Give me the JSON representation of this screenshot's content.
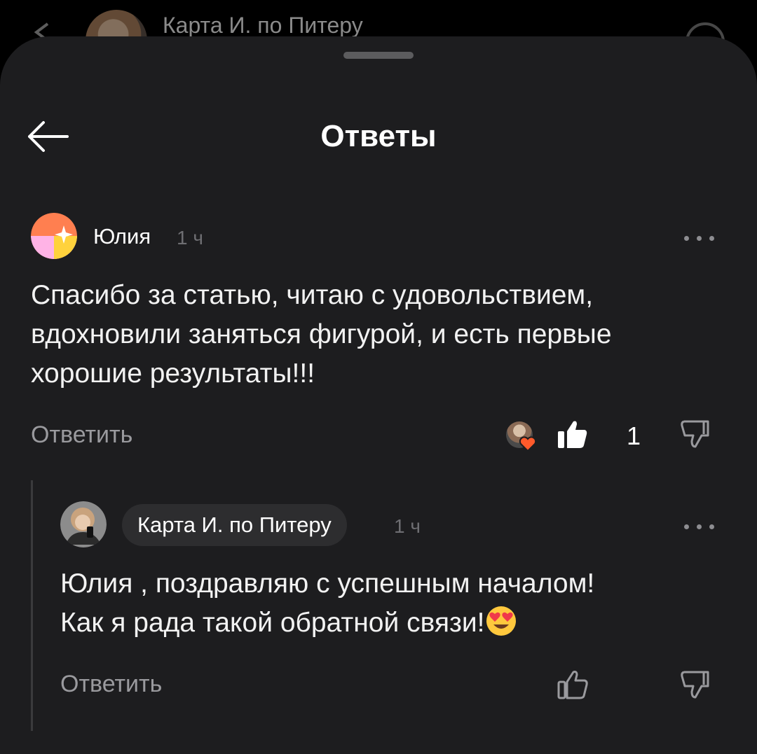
{
  "background": {
    "title": "Карта И. по Питеру"
  },
  "sheet": {
    "title": "Ответы"
  },
  "comment": {
    "author": "Юлия",
    "time": "1 ч",
    "text_lines": [
      "Спасибо за статью, читаю с удовольствием,",
      "вдохновили заняться фигурой, и есть первые",
      "хорошие результаты!!!"
    ],
    "reply_label": "Ответить",
    "likes": "1"
  },
  "reply": {
    "author": "Карта И. по Питеру",
    "time": "1 ч",
    "text_lines": [
      "Юлия , поздравляю с успешным началом!",
      "Как я рада такой обратной связи!"
    ],
    "reply_label": "Ответить"
  },
  "colors": {
    "sheet_bg": "#1d1d1f",
    "chip_bg": "#2d2d2f",
    "muted_text": "#9a9a9e",
    "time_text": "#6e6e72"
  },
  "icons": [
    "back-arrow-icon",
    "more-dots-icon",
    "thumbs-up-icon",
    "thumbs-down-icon",
    "heart-icon",
    "heart-eyes-emoji-icon"
  ]
}
